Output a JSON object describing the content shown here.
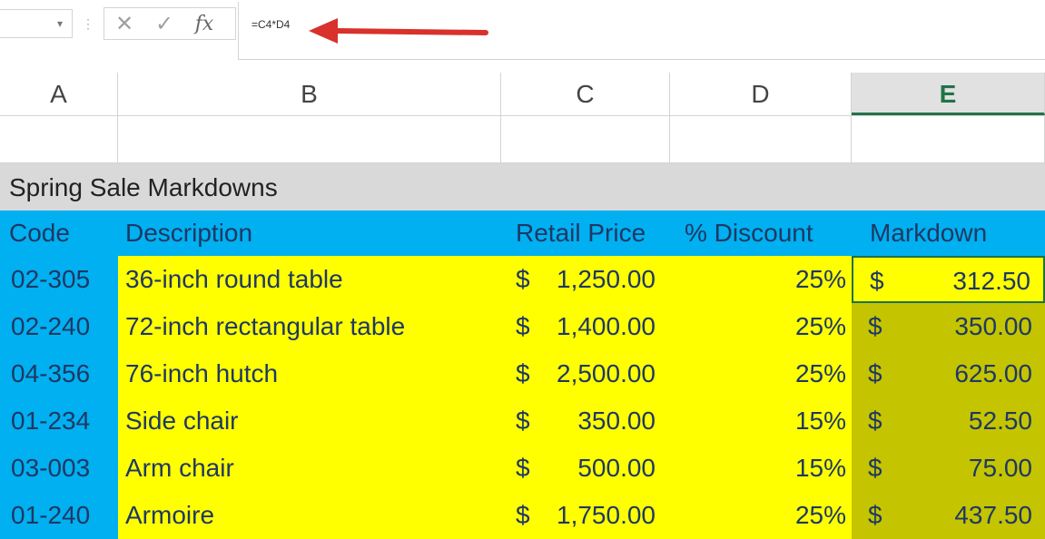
{
  "formula_bar": {
    "name_box_arrow": "▾",
    "separator": "⋮",
    "cancel_icon": "✕",
    "enter_icon": "✓",
    "fx_label": "fx",
    "formula": "=C4*D4"
  },
  "columns": [
    "A",
    "B",
    "C",
    "D",
    "E"
  ],
  "sheet": {
    "title": "Spring Sale Markdowns",
    "headers": {
      "code": "Code",
      "description": "Description",
      "retail_price": "Retail Price",
      "discount": "% Discount",
      "markdown": "Markdown"
    },
    "rows": [
      {
        "code": "02-305",
        "description": "36-inch round table",
        "price_symbol": "$",
        "price": "1,250.00",
        "discount": "25%",
        "markdown_symbol": "$",
        "markdown": "312.50"
      },
      {
        "code": "02-240",
        "description": "72-inch rectangular table",
        "price_symbol": "$",
        "price": "1,400.00",
        "discount": "25%",
        "markdown_symbol": "$",
        "markdown": "350.00"
      },
      {
        "code": "04-356",
        "description": "76-inch hutch",
        "price_symbol": "$",
        "price": "2,500.00",
        "discount": "25%",
        "markdown_symbol": "$",
        "markdown": "625.00"
      },
      {
        "code": "01-234",
        "description": "Side chair",
        "price_symbol": "$",
        "price": "350.00",
        "discount": "15%",
        "markdown_symbol": "$",
        "markdown": "52.50"
      },
      {
        "code": "03-003",
        "description": "Arm chair",
        "price_symbol": "$",
        "price": "500.00",
        "discount": "15%",
        "markdown_symbol": "$",
        "markdown": "75.00"
      },
      {
        "code": "01-240",
        "description": "Armoire",
        "price_symbol": "$",
        "price": "1,750.00",
        "discount": "25%",
        "markdown_symbol": "$",
        "markdown": "437.50"
      }
    ]
  },
  "colors": {
    "header_blue": "#00b0f0",
    "highlight_yellow": "#ffff00",
    "selected_range": "#c4c400",
    "title_gray": "#d9d9d9",
    "excel_green": "#217346",
    "annotation_red": "#d9312b"
  },
  "icons": {
    "cancel": "close-icon",
    "enter": "check-icon",
    "function": "fx-icon",
    "arrow": "red-arrow-annotation"
  }
}
